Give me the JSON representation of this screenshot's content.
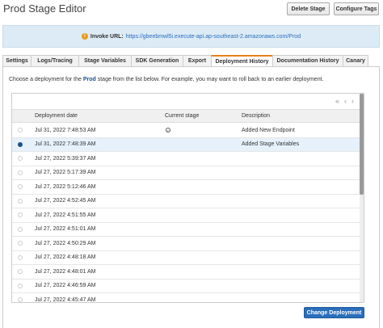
{
  "page": {
    "title": "Prod Stage Editor",
    "delete_stage": "Delete Stage",
    "configure_tags": "Configure Tags"
  },
  "invoke": {
    "label": "Invoke URL:",
    "url": "https://gbeebmwl5i.execute-api.ap-southeast-2.amazonaws.com/Prod"
  },
  "tabs": [
    {
      "label": "Settings",
      "active": false
    },
    {
      "label": "Logs/Tracing",
      "active": false
    },
    {
      "label": "Stage Variables",
      "active": false
    },
    {
      "label": "SDK Generation",
      "active": false
    },
    {
      "label": "Export",
      "active": false
    },
    {
      "label": "Deployment History",
      "active": true
    },
    {
      "label": "Documentation History",
      "active": false
    },
    {
      "label": "Canary",
      "active": false
    }
  ],
  "description": {
    "prefix": "Choose a deployment for the ",
    "stage": "Prod",
    "suffix": " stage from the list below. For example, you may want to roll back to an earlier deployment."
  },
  "table": {
    "headers": {
      "date": "Deployment date",
      "current": "Current stage",
      "description": "Description"
    },
    "rows": [
      {
        "date": "Jul 31, 2022 7:48:53 AM",
        "current": true,
        "description": "Added New Endpoint",
        "selected": false
      },
      {
        "date": "Jul 31, 2022 7:48:39 AM",
        "current": false,
        "description": "Added Stage Variables",
        "selected": true
      },
      {
        "date": "Jul 27, 2022 5:39:37 AM",
        "current": false,
        "description": "",
        "selected": false
      },
      {
        "date": "Jul 27, 2022 5:17:39 AM",
        "current": false,
        "description": "",
        "selected": false
      },
      {
        "date": "Jul 27, 2022 5:12:46 AM",
        "current": false,
        "description": "",
        "selected": false
      },
      {
        "date": "Jul 27, 2022 4:52:45 AM",
        "current": false,
        "description": "",
        "selected": false
      },
      {
        "date": "Jul 27, 2022 4:51:55 AM",
        "current": false,
        "description": "",
        "selected": false
      },
      {
        "date": "Jul 27, 2022 4:51:01 AM",
        "current": false,
        "description": "",
        "selected": false
      },
      {
        "date": "Jul 27, 2022 4:50:29 AM",
        "current": false,
        "description": "",
        "selected": false
      },
      {
        "date": "Jul 27, 2022 4:48:18 AM",
        "current": false,
        "description": "",
        "selected": false
      },
      {
        "date": "Jul 27, 2022 4:48:01 AM",
        "current": false,
        "description": "",
        "selected": false
      },
      {
        "date": "Jul 27, 2022 4:46:59 AM",
        "current": false,
        "description": "",
        "selected": false
      },
      {
        "date": "Jul 27, 2022 4:45:47 AM",
        "current": false,
        "description": "",
        "selected": false
      }
    ]
  },
  "footer": {
    "change_deployment": "Change Deployment"
  }
}
